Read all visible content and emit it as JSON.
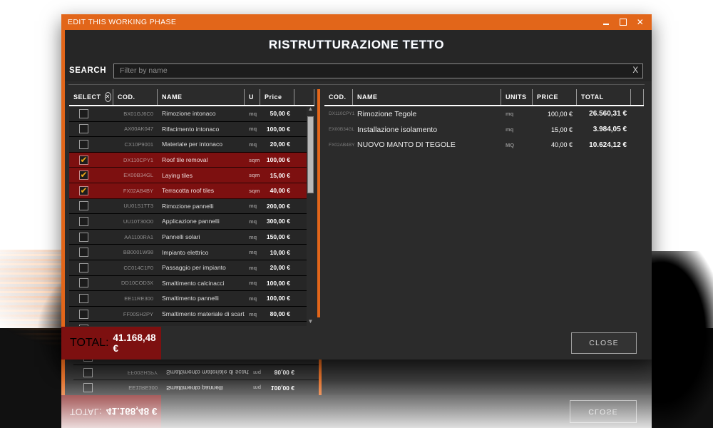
{
  "window": {
    "titlebar_text": "EDIT THIS WORKING PHASE",
    "minimize_glyph": "minimize-icon",
    "maximize_glyph": "maximize-icon",
    "close_glyph": "✕",
    "app_title": "RISTRUTTURAZIONE TETTO",
    "accent_color": "#e2661a",
    "selection_color": "#7d1010",
    "background_color": "#2b2b2b"
  },
  "search": {
    "label": "SEARCH",
    "placeholder": "Filter by name",
    "value": "",
    "clear_label": "X"
  },
  "left_table": {
    "headers": {
      "select": "SELECT",
      "select_icon": "circled-x-icon",
      "cod": "COD.",
      "name": "NAME",
      "u": "U",
      "price": "Price",
      "end": ""
    },
    "rows": [
      {
        "checked": false,
        "cod": "BX01GJ6C0",
        "name": "Rimozione intonaco",
        "u": "mq",
        "price": "50,00 €"
      },
      {
        "checked": false,
        "cod": "AX00AK047",
        "name": "Rifacimento intonaco",
        "u": "mq",
        "price": "100,00 €"
      },
      {
        "checked": false,
        "cod": "CX10P9001",
        "name": "Materiale per intonaco",
        "u": "mq",
        "price": "20,00 €"
      },
      {
        "checked": true,
        "cod": "DX110CPY1",
        "name": "Roof tile removal",
        "u": "sqm",
        "price": "100,00 €"
      },
      {
        "checked": true,
        "cod": "EX00B34GL",
        "name": "Laying tiles",
        "u": "sqm",
        "price": "15,00 €"
      },
      {
        "checked": true,
        "cod": "FX02AB4BY",
        "name": "Terracotta roof tiles",
        "u": "sqm",
        "price": "40,00 €"
      },
      {
        "checked": false,
        "cod": "UU01S1TT3",
        "name": "Rimozione pannelli",
        "u": "mq",
        "price": "200,00 €"
      },
      {
        "checked": false,
        "cod": "UU10T30O0",
        "name": "Applicazione pannelli",
        "u": "mq",
        "price": "300,00 €"
      },
      {
        "checked": false,
        "cod": "AA1100RA1",
        "name": "Pannelli solari",
        "u": "mq",
        "price": "150,00 €"
      },
      {
        "checked": false,
        "cod": "BB0001W98",
        "name": "Impianto elettrico",
        "u": "mq",
        "price": "10,00 €"
      },
      {
        "checked": false,
        "cod": "CC014C1F0",
        "name": "Passaggio per impianto",
        "u": "mq",
        "price": "20,00 €"
      },
      {
        "checked": false,
        "cod": "DD10COD3X",
        "name": "Smaltimento calcinacci",
        "u": "mq",
        "price": "100,00 €"
      },
      {
        "checked": false,
        "cod": "EE11RE300",
        "name": "Smaltimento pannelli",
        "u": "mq",
        "price": "100,00 €"
      },
      {
        "checked": false,
        "cod": "FF00SH2PY",
        "name": "Smaltimento materiale di scarto",
        "u": "mq",
        "price": "80,00 €"
      },
      {
        "checked": false,
        "cod": "",
        "name": "",
        "u": "",
        "price": ""
      }
    ],
    "scrollbar": {
      "up_arrow": "▲",
      "down_arrow": "▼"
    }
  },
  "right_table": {
    "headers": {
      "cod": "COD.",
      "name": "NAME",
      "units": "UNITS",
      "price": "PRICE",
      "total": "TOTAL",
      "end": ""
    },
    "rows": [
      {
        "cod": "DX110CPY1",
        "name": "Rimozione Tegole",
        "units": "mq",
        "price": "100,00 €",
        "total": "26.560,31 €"
      },
      {
        "cod": "EX00B34GL",
        "name": "Installazione isolamento",
        "units": "mq",
        "price": "15,00 €",
        "total": "3.984,05 €"
      },
      {
        "cod": "FX02AB4BY",
        "name": "NUOVO MANTO DI TEGOLE",
        "units": "MQ",
        "price": "40,00 €",
        "total": "10.624,12 €"
      }
    ]
  },
  "footer": {
    "total_label": "TOTAL:",
    "total_value": "41.168,48 €",
    "close_label": "CLOSE"
  }
}
